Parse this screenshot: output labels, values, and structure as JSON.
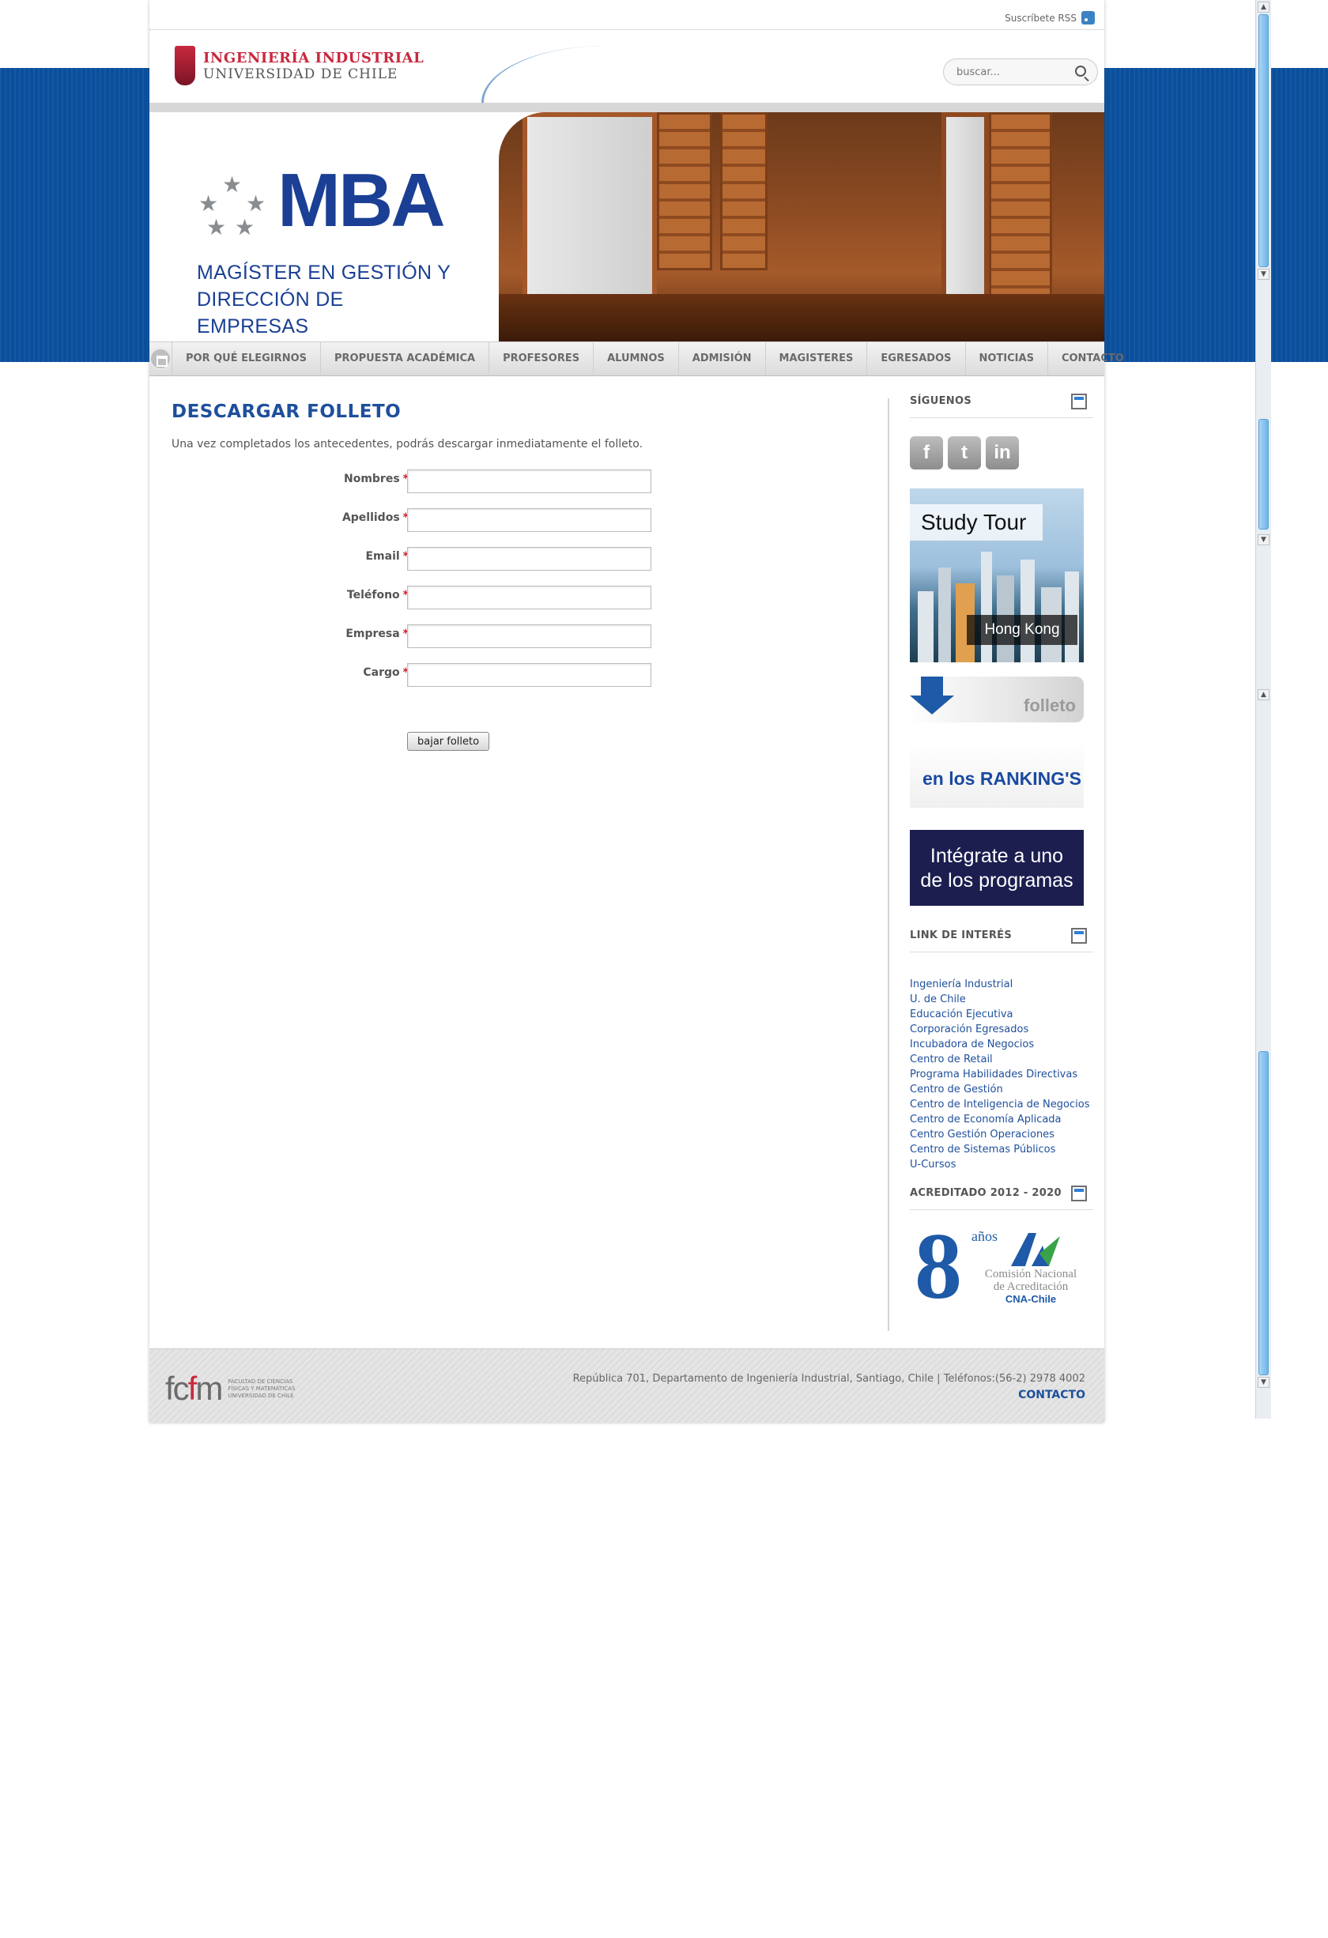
{
  "topbar": {
    "rss_label": "Suscríbete RSS"
  },
  "header": {
    "logo_line1": "INGENIERÍA INDUSTRIAL",
    "logo_line2": "UNIVERSIDAD DE CHILE",
    "search_placeholder": "buscar..."
  },
  "hero": {
    "mba_word": "MBA",
    "mba_sub_line1": "MAGÍSTER EN GESTIÓN Y",
    "mba_sub_line2": "DIRECCIÓN DE EMPRESAS"
  },
  "nav": {
    "items": [
      {
        "label": "POR QUÉ ELEGIRNOS"
      },
      {
        "label": "PROPUESTA ACADÉMICA"
      },
      {
        "label": "PROFESORES"
      },
      {
        "label": "ALUMNOS"
      },
      {
        "label": "ADMISIÓN"
      },
      {
        "label": "MAGISTERES"
      },
      {
        "label": "EGRESADOS"
      },
      {
        "label": "NOTICIAS"
      },
      {
        "label": "CONTACTO"
      }
    ]
  },
  "main": {
    "title": "DESCARGAR FOLLETO",
    "intro": "Una vez completados los antecedentes, podrás descargar inmediatamente el folleto.",
    "form": {
      "fields": [
        {
          "label": "Nombres",
          "required_mark": "*",
          "value": ""
        },
        {
          "label": "Apellidos",
          "required_mark": "*",
          "value": ""
        },
        {
          "label": "Email",
          "required_mark": "*",
          "value": ""
        },
        {
          "label": "Teléfono",
          "required_mark": "*",
          "value": ""
        },
        {
          "label": "Empresa",
          "required_mark": "*",
          "value": ""
        },
        {
          "label": "Cargo",
          "required_mark": "*",
          "value": ""
        }
      ],
      "submit_label": "bajar folleto"
    }
  },
  "sidebar": {
    "follow_heading": "SÍGUENOS",
    "social": [
      {
        "name": "facebook",
        "glyph": "f"
      },
      {
        "name": "twitter",
        "glyph": "t"
      },
      {
        "name": "linkedin",
        "glyph": "in"
      }
    ],
    "study_tour": {
      "title": "Study Tour",
      "city": "Hong Kong"
    },
    "folleto_label": "folleto",
    "ranking_label": "en los RANKING'S",
    "integrate_line1": "Intégrate a uno",
    "integrate_line2": "de los programas",
    "links_heading": "LINK DE INTERÉS",
    "links": [
      "Ingeniería Industrial",
      "U. de Chile",
      "Educación Ejecutiva",
      "Corporación Egresados",
      "Incubadora de Negocios",
      "Centro de Retail",
      "Programa Habilidades Directivas",
      "Centro de Gestión",
      "Centro de Inteligencia de Negocios",
      "Centro de Economía Aplicada",
      "Centro Gestión Operaciones",
      "Centro de Sistemas Públicos",
      "U-Cursos"
    ],
    "accred_heading": "ACREDITADO 2012 - 2020",
    "accred_years": "8",
    "accred_years_label": "años",
    "accred_org": "Comisión Nacional de Acreditación",
    "accred_short": "CNA-Chile"
  },
  "footer": {
    "logo_mark_left": "fc",
    "logo_mark_red": "f",
    "logo_mark_right": "m",
    "logo_small": "FACULTAD DE CIENCIAS FÍSICAS Y MATEMÁTICAS UNIVERSIDAD DE CHILE",
    "address": "República 701, Departamento de Ingeniería Industrial, Santiago, Chile | Teléfonos:(56-2) 2978 4002",
    "contact_label": "CONTACTO"
  },
  "colors": {
    "brand_blue": "#1e4f9c",
    "band_blue": "#0a4f9c",
    "brand_red": "#c9283e"
  }
}
